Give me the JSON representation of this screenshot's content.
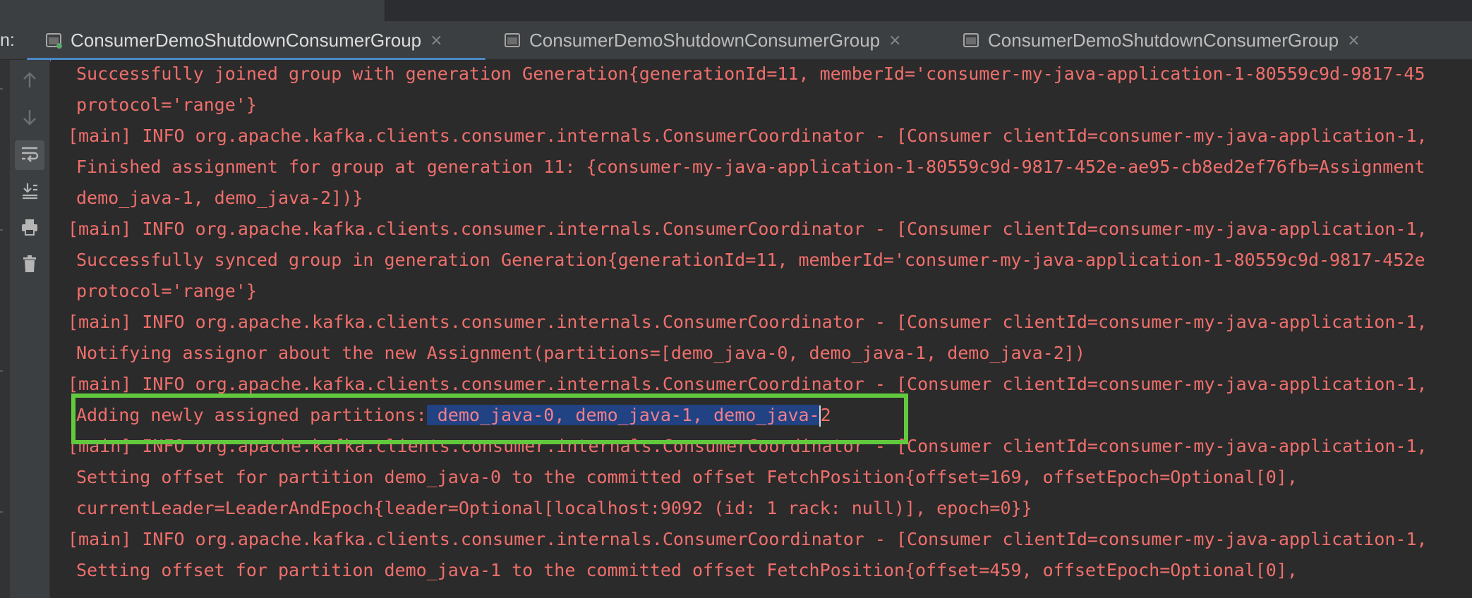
{
  "window": {
    "run_label": "n:",
    "tabs": [
      {
        "title": "ConsumerDemoShutdownConsumerGroup",
        "active": true
      },
      {
        "title": "ConsumerDemoShutdownConsumerGroup",
        "active": false
      },
      {
        "title": "ConsumerDemoShutdownConsumerGroup",
        "active": false
      }
    ],
    "tab_close_glyph": "×"
  },
  "toolbar": {
    "buttons": [
      {
        "icon": "arrow-up-icon"
      },
      {
        "icon": "arrow-down-icon"
      },
      {
        "icon": "soft-wrap-icon",
        "active": true
      },
      {
        "icon": "scroll-to-end-icon"
      },
      {
        "icon": "print-icon"
      },
      {
        "icon": "trash-icon"
      }
    ]
  },
  "console": {
    "lines": [
      "Successfully joined group with generation Generation{generationId=11, memberId='consumer-my-java-application-1-80559c9d-9817-45",
      "protocol='range'}",
      "[main] INFO org.apache.kafka.clients.consumer.internals.ConsumerCoordinator - [Consumer clientId=consumer-my-java-application-1,",
      "Finished assignment for group at generation 11: {consumer-my-java-application-1-80559c9d-9817-452e-ae95-cb8ed2ef76fb=Assignment",
      "demo_java-1, demo_java-2])}",
      "[main] INFO org.apache.kafka.clients.consumer.internals.ConsumerCoordinator - [Consumer clientId=consumer-my-java-application-1,",
      "Successfully synced group in generation Generation{generationId=11, memberId='consumer-my-java-application-1-80559c9d-9817-452e",
      "protocol='range'}",
      "[main] INFO org.apache.kafka.clients.consumer.internals.ConsumerCoordinator - [Consumer clientId=consumer-my-java-application-1,",
      "Notifying assignor about the new Assignment(partitions=[demo_java-0, demo_java-1, demo_java-2])",
      "[main] INFO org.apache.kafka.clients.consumer.internals.ConsumerCoordinator - [Consumer clientId=consumer-my-java-application-1,",
      "Adding newly assigned partitions: demo_java-0, demo_java-1, demo_java-2",
      "[main] INFO org.apache.kafka.clients.consumer.internals.ConsumerCoordinator - [Consumer clientId=consumer-my-java-application-1,",
      "Setting offset for partition demo_java-0 to the committed offset FetchPosition{offset=169, offsetEpoch=Optional[0],",
      "currentLeader=LeaderAndEpoch{leader=Optional[localhost:9092 (id: 1 rack: null)], epoch=0}}",
      "[main] INFO org.apache.kafka.clients.consumer.internals.ConsumerCoordinator - [Consumer clientId=consumer-my-java-application-1,",
      "Setting offset for partition demo_java-1 to the committed offset FetchPosition{offset=459, offsetEpoch=Optional[0],"
    ],
    "selection": {
      "prefix": "Adding newly assigned partitions:",
      "selected": " demo_java-0, demo_java-1, demo_java-",
      "suffix": "2"
    },
    "text_color": "#ef6f6c",
    "selection_color": "#214283",
    "highlight_color": "#62c93e"
  }
}
